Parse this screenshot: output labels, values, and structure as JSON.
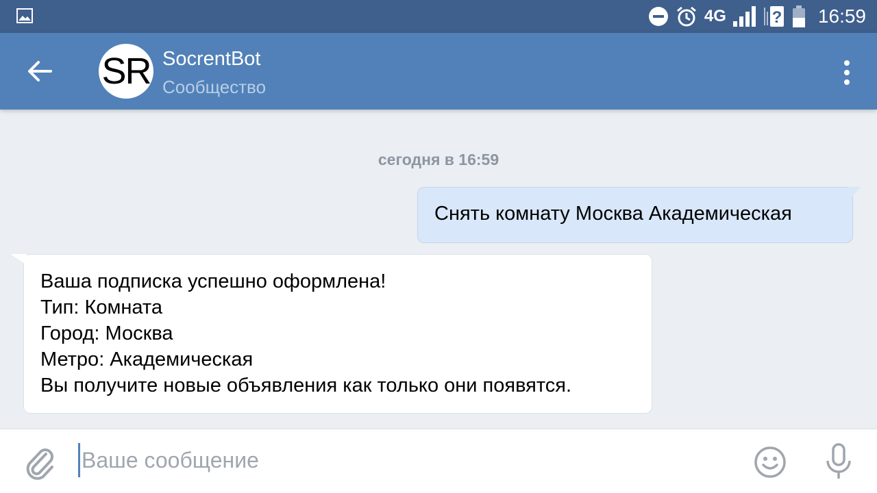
{
  "status_bar": {
    "network": "4G",
    "time": "16:59",
    "icons": [
      "image-icon",
      "do-not-disturb-icon",
      "alarm-icon",
      "signal-icon",
      "sim-unknown-icon",
      "battery-icon"
    ]
  },
  "header": {
    "avatar_text": "SR",
    "title": "SocrentBot",
    "subtitle": "Сообщество",
    "icons": [
      "back-arrow-icon",
      "more-vert-icon"
    ]
  },
  "chat": {
    "date_separator": "сегодня в 16:59",
    "messages": [
      {
        "direction": "outgoing",
        "lines": [
          "Снять комнату Москва Академическая"
        ]
      },
      {
        "direction": "incoming",
        "lines": [
          "Ваша подписка успешно оформлена!",
          "Тип: Комната",
          "Город: Москва",
          "Метро: Академическая",
          "Вы получите новые объявления как только они появятся."
        ]
      }
    ]
  },
  "composer": {
    "placeholder": "Ваше сообщение",
    "value": "",
    "icons": [
      "paperclip-icon",
      "emoji-icon",
      "microphone-icon"
    ]
  },
  "colors": {
    "status_bar": "#3f5f8d",
    "header": "#5181b8",
    "chat_background": "#ebeef2",
    "outgoing_bubble": "#d8e7f9",
    "incoming_bubble": "#ffffff"
  }
}
